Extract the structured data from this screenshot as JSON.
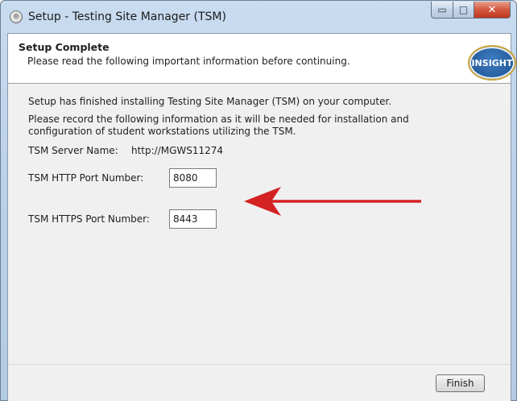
{
  "window": {
    "title": "Setup - Testing Site Manager (TSM)",
    "app_icon": "setup-icon",
    "minimize_glyph": "▭",
    "maximize_glyph": "□",
    "close_glyph": "✕"
  },
  "header": {
    "title": "Setup Complete",
    "subtitle": "Please read the following important information before continuing.",
    "logo_text": "INSIGHT"
  },
  "content": {
    "paragraph1": "Setup has finished installing Testing Site Manager (TSM) on your computer.",
    "paragraph2_line1": "Please record the following information as it will be needed for installation and",
    "paragraph2_line2": "configuration of student workstations utilizing the TSM.",
    "server_name_label": "TSM Server Name:",
    "server_name_value": "http://MGWS11274",
    "http_port_label": "TSM HTTP Port Number:",
    "http_port_value": "8080",
    "https_port_label": "TSM HTTPS Port Number:",
    "https_port_value": "8443"
  },
  "footer": {
    "finish_label": "Finish"
  },
  "colors": {
    "arrow": "#d42222",
    "title_bar": "#bcd2ea",
    "close_button": "#c9432a"
  }
}
